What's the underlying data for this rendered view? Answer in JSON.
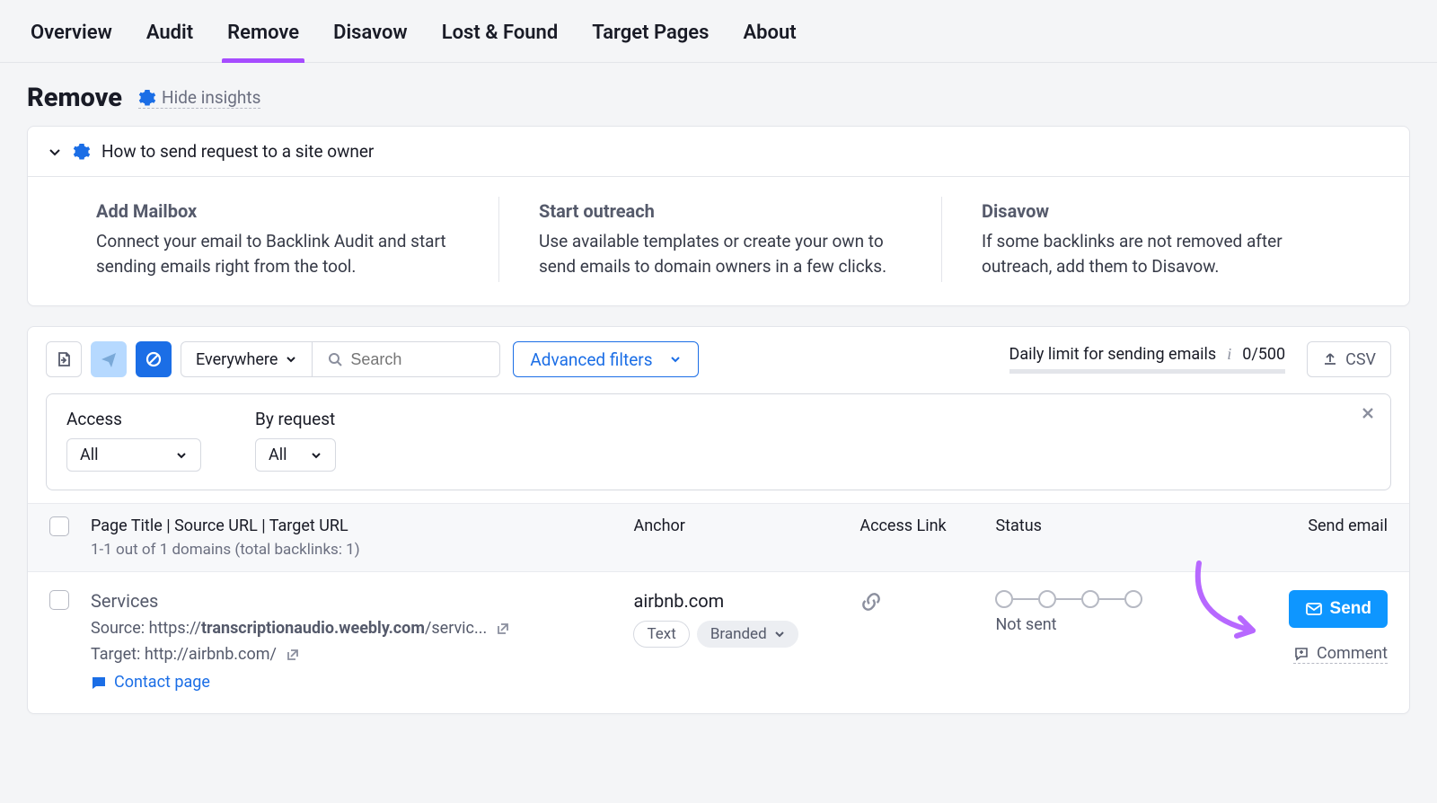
{
  "nav": {
    "items": [
      "Overview",
      "Audit",
      "Remove",
      "Disavow",
      "Lost & Found",
      "Target Pages",
      "About"
    ],
    "active_index": 2
  },
  "header": {
    "title": "Remove",
    "hide_insights_label": "Hide insights"
  },
  "insights": {
    "heading": "How to send request to a site owner",
    "cols": [
      {
        "title": "Add Mailbox",
        "text": "Connect your email to Backlink Audit and start sending emails right from the tool."
      },
      {
        "title": "Start outreach",
        "text": "Use available templates or create your own to send emails to domain owners in a few clicks."
      },
      {
        "title": "Disavow",
        "text": "If some backlinks are not removed after outreach, add them to Disavow."
      }
    ]
  },
  "toolbar": {
    "scope_label": "Everywhere",
    "search_placeholder": "Search",
    "advanced_filters_label": "Advanced filters",
    "limit_label": "Daily limit for sending emails",
    "limit_value": "0/500",
    "csv_label": "CSV"
  },
  "filters": {
    "access_label": "Access",
    "access_value": "All",
    "byrequest_label": "By request",
    "byrequest_value": "All"
  },
  "table": {
    "header": {
      "page": "Page Title | Source URL | Target URL",
      "subhead": "1-1 out of 1 domains (total backlinks: 1)",
      "anchor": "Anchor",
      "access": "Access Link",
      "status": "Status",
      "send": "Send email"
    },
    "row": {
      "title": "Services",
      "source_prefix": "Source: ",
      "source_proto": "https://",
      "source_domain": "transcriptionaudio.weebly.com",
      "source_path": "/servic...",
      "target_prefix": "Target: ",
      "target_url": "http://airbnb.com/",
      "contact_label": "Contact page",
      "anchor": "airbnb.com",
      "anchor_tag_text": "Text",
      "anchor_tag_branded": "Branded",
      "status_label": "Not sent",
      "send_label": "Send",
      "comment_label": "Comment"
    }
  }
}
